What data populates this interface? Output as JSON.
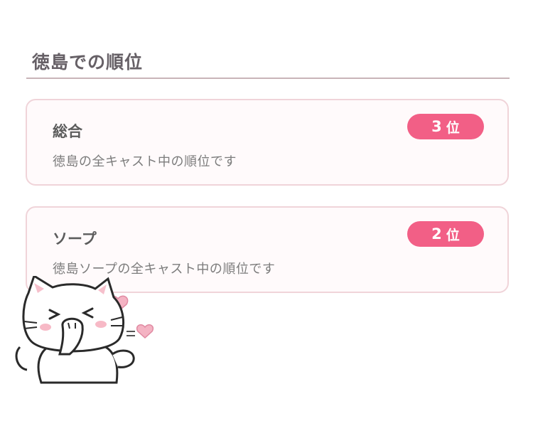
{
  "section": {
    "title": "徳島での順位"
  },
  "rankings": [
    {
      "category": "総合",
      "rank": "3",
      "unit": "位",
      "description": "徳島の全キャスト中の順位です"
    },
    {
      "category": "ソープ",
      "rank": "2",
      "unit": "位",
      "description": "徳島ソープの全キャスト中の順位です"
    }
  ],
  "colors": {
    "badge": "#f25f86",
    "card_border": "#f0d4d9",
    "divider": "#c9b4b8",
    "title_text": "#666066"
  },
  "decoration": {
    "sticker": "cat-giggling-sticker-icon"
  }
}
